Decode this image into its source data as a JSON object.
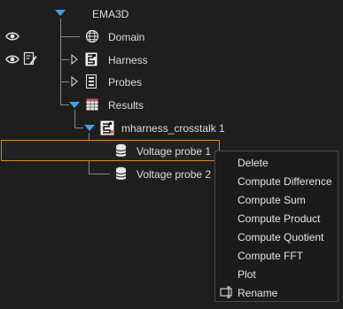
{
  "tree": {
    "root_label": "EMA3D",
    "domain_label": "Domain",
    "harness_label": "Harness",
    "probes_label": "Probes",
    "results_label": "Results",
    "crosstalk_label": "mharness_crosstalk 1",
    "probe1_label": "Voltage probe 1",
    "probe2_label": "Voltage probe 2"
  },
  "context_menu": {
    "items": [
      "Delete",
      "Compute Difference",
      "Compute Sum",
      "Compute Product",
      "Compute Quotient",
      "Compute FFT",
      "Plot",
      "Rename"
    ]
  },
  "colors": {
    "background": "#1e1e1e",
    "selection_border": "#d38a2a",
    "expand_arrow": "#3fa3e6",
    "text": "#dcdcdc"
  },
  "icons": {
    "visibility": "eye-icon",
    "edit": "edit-icon",
    "domain": "globe-icon",
    "harness": "harness-icon",
    "probes": "probes-icon",
    "results": "results-table-icon",
    "crosstalk": "crosstalk-icon",
    "probe": "database-icon",
    "rename": "rename-icon"
  }
}
